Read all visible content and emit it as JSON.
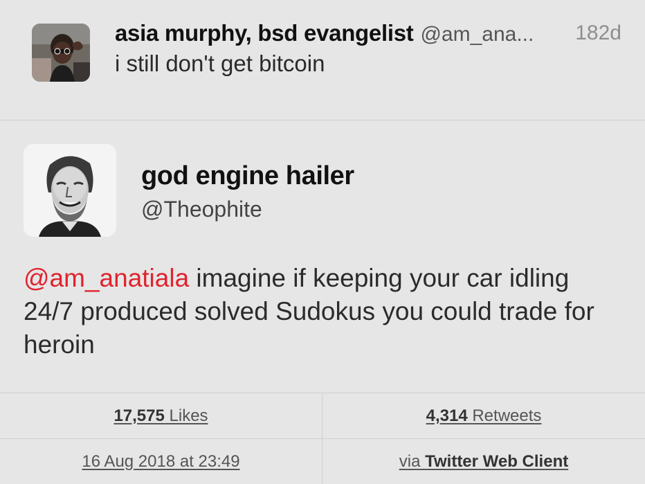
{
  "parent_tweet": {
    "author_name": "asia murphy, bsd evangelist",
    "author_handle": "@am_ana...",
    "age": "182d",
    "text": "i still don't get bitcoin"
  },
  "main_tweet": {
    "author_name": "god engine hailer",
    "author_handle": "@Theophite",
    "mention": "@am_anatiala",
    "text": " imagine if keeping your car idling 24/7 produced solved Sudokus you could trade for heroin"
  },
  "stats": {
    "likes_count": "17,575",
    "likes_label": "Likes",
    "retweets_count": "4,314",
    "retweets_label": "Retweets",
    "timestamp": "16 Aug 2018 at 23:49",
    "via_prefix": "via",
    "client": "Twitter Web Client"
  },
  "colors": {
    "background": "#e6e6e6",
    "mention": "#e0232e",
    "divider": "#cfcfcf"
  }
}
